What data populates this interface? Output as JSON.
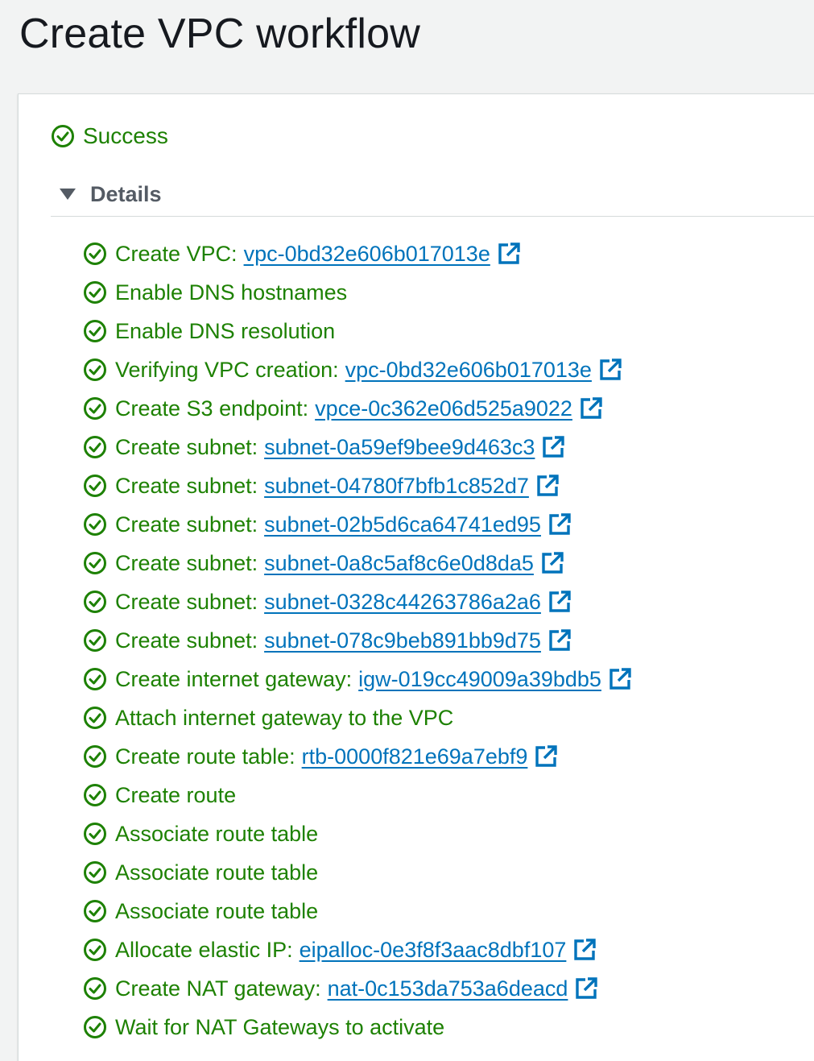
{
  "page": {
    "title": "Create VPC workflow"
  },
  "status": {
    "text": "Success",
    "icon": "check-circle-icon",
    "color": "#1d8102"
  },
  "details": {
    "label": "Details",
    "expanded": true
  },
  "colors": {
    "success": "#1d8102",
    "link": "#0073bb"
  },
  "steps": [
    {
      "label": "Create VPC:",
      "link": "vpc-0bd32e606b017013e"
    },
    {
      "label": "Enable DNS hostnames",
      "link": null
    },
    {
      "label": "Enable DNS resolution",
      "link": null
    },
    {
      "label": "Verifying VPC creation:",
      "link": "vpc-0bd32e606b017013e"
    },
    {
      "label": "Create S3 endpoint:",
      "link": "vpce-0c362e06d525a9022"
    },
    {
      "label": "Create subnet:",
      "link": "subnet-0a59ef9bee9d463c3"
    },
    {
      "label": "Create subnet:",
      "link": "subnet-04780f7bfb1c852d7"
    },
    {
      "label": "Create subnet:",
      "link": "subnet-02b5d6ca64741ed95"
    },
    {
      "label": "Create subnet:",
      "link": "subnet-0a8c5af8c6e0d8da5"
    },
    {
      "label": "Create subnet:",
      "link": "subnet-0328c44263786a2a6"
    },
    {
      "label": "Create subnet:",
      "link": "subnet-078c9beb891bb9d75"
    },
    {
      "label": "Create internet gateway:",
      "link": "igw-019cc49009a39bdb5"
    },
    {
      "label": "Attach internet gateway to the VPC",
      "link": null
    },
    {
      "label": "Create route table:",
      "link": "rtb-0000f821e69a7ebf9"
    },
    {
      "label": "Create route",
      "link": null
    },
    {
      "label": "Associate route table",
      "link": null
    },
    {
      "label": "Associate route table",
      "link": null
    },
    {
      "label": "Associate route table",
      "link": null
    },
    {
      "label": "Allocate elastic IP:",
      "link": "eipalloc-0e3f8f3aac8dbf107"
    },
    {
      "label": "Create NAT gateway:",
      "link": "nat-0c153da753a6deacd"
    },
    {
      "label": "Wait for NAT Gateways to activate",
      "link": null
    }
  ]
}
